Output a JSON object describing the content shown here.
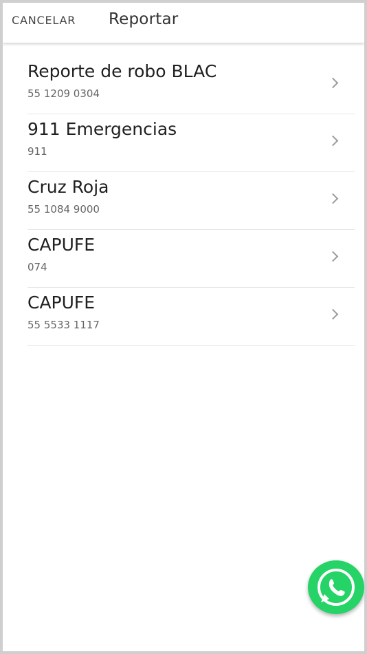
{
  "header": {
    "cancel_label": "CANCELAR",
    "title": "Reportar"
  },
  "contacts": [
    {
      "name": "Reporte de robo BLAC",
      "number": "55 1209 0304"
    },
    {
      "name": "911 Emergencias",
      "number": "911"
    },
    {
      "name": "Cruz Roja",
      "number": "55 1084 9000"
    },
    {
      "name": "CAPUFE",
      "number": "074"
    },
    {
      "name": "CAPUFE",
      "number": "55 5533 1117"
    }
  ],
  "icons": {
    "row_action": "chevron-right-icon",
    "floating_action": "whatsapp-icon"
  },
  "colors": {
    "whatsapp_green": "#25d366",
    "divider": "#e6e6e6"
  }
}
